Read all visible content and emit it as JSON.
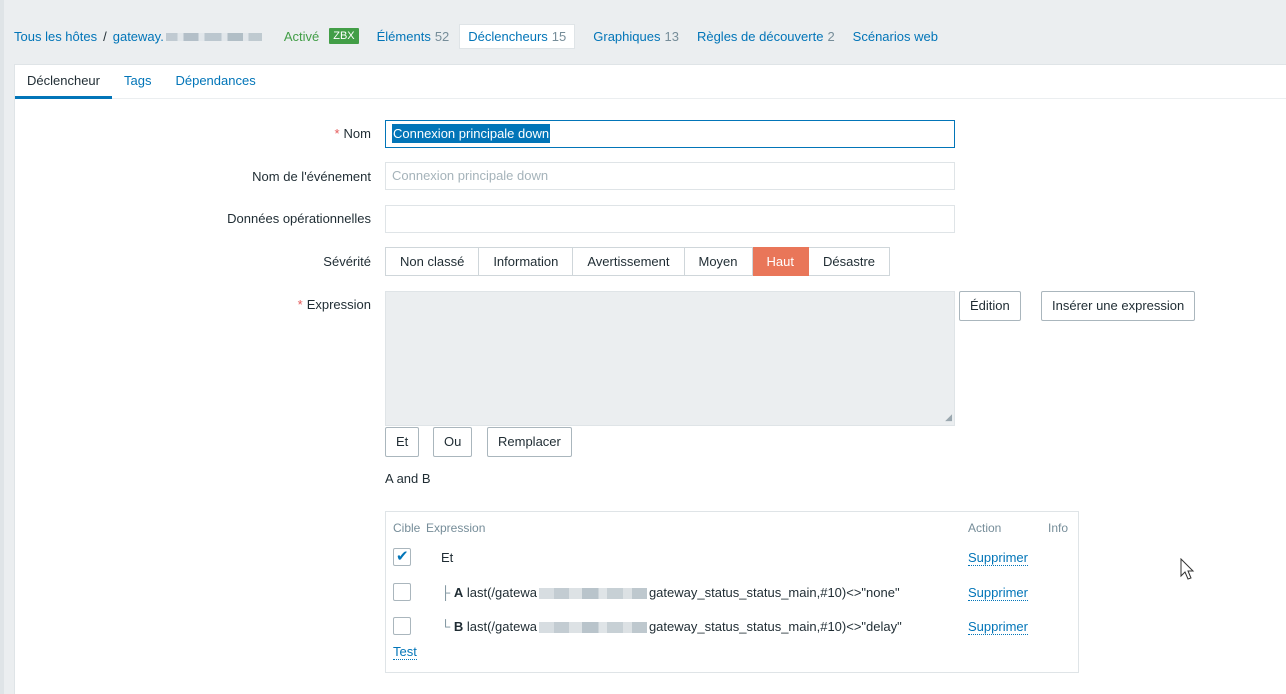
{
  "breadcrumb": {
    "all_hosts": "Tous les hôtes",
    "separator": "/",
    "host": "gateway.",
    "status": "Activé",
    "zbx": "ZBX"
  },
  "nav": {
    "items": [
      {
        "label": "Éléments",
        "count": "52"
      },
      {
        "label": "Déclencheurs",
        "count": "15",
        "active": true
      },
      {
        "label": "Graphiques",
        "count": "13"
      },
      {
        "label": "Règles de découverte",
        "count": "2"
      },
      {
        "label": "Scénarios web",
        "count": ""
      }
    ]
  },
  "tabs": [
    "Déclencheur",
    "Tags",
    "Dépendances"
  ],
  "form": {
    "name_label": "Nom",
    "name_value": "Connexion principale down",
    "event_name_label": "Nom de l'événement",
    "event_name_placeholder": "Connexion principale down",
    "opdata_label": "Données opérationnelles",
    "opdata_value": "",
    "severity_label": "Sévérité",
    "severities": [
      "Non classé",
      "Information",
      "Avertissement",
      "Moyen",
      "Haut",
      "Désastre"
    ],
    "severity_selected": "Haut",
    "expression_label": "Expression",
    "edit_button": "Édition",
    "insert_button": "Insérer une expression",
    "and_button": "Et",
    "or_button": "Ou",
    "replace_button": "Remplacer",
    "expression_summary": "A and B"
  },
  "builder": {
    "headers": {
      "target": "Cible",
      "expression": "Expression",
      "action": "Action",
      "info": "Info"
    },
    "rows": [
      {
        "tree": "",
        "key": "",
        "prefix": "Et",
        "suffix": "",
        "checked": true,
        "action": "Supprimer"
      },
      {
        "tree": "├",
        "key": "A",
        "prefix": "last(/gatewa",
        "suffix": "gateway_status_status_main,#10)<>\"none\"",
        "checked": false,
        "action": "Supprimer"
      },
      {
        "tree": "└",
        "key": "B",
        "prefix": "last(/gatewa",
        "suffix": "gateway_status_status_main,#10)<>\"delay\"",
        "checked": false,
        "action": "Supprimer"
      }
    ],
    "test_link": "Test"
  },
  "colors": {
    "accent": "#0275b8",
    "active_status": "#429e47",
    "severity_high": "#e97659",
    "required": "#e45959"
  }
}
